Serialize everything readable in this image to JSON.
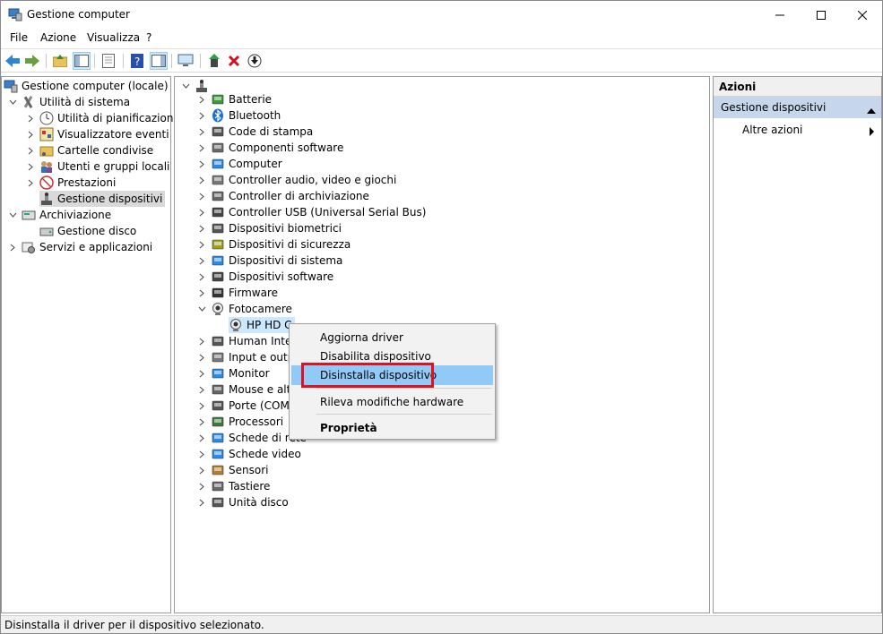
{
  "window": {
    "title": "Gestione computer"
  },
  "menu": {
    "file": "File",
    "action": "Azione",
    "view": "Visualizza",
    "help": "?"
  },
  "tree_left": {
    "root": "Gestione computer (locale)",
    "system_tools": "Utilità di sistema",
    "task_scheduler": "Utilità di pianificazione",
    "event_viewer": "Visualizzatore eventi",
    "shared_folders": "Cartelle condivise",
    "users_groups": "Utenti e gruppi locali",
    "performance": "Prestazioni",
    "device_manager": "Gestione dispositivi",
    "storage": "Archiviazione",
    "disk_management": "Gestione disco",
    "services_apps": "Servizi e applicazioni"
  },
  "devices": {
    "batteries": "Batterie",
    "bluetooth": "Bluetooth",
    "print_queues": "Code di stampa",
    "software_components": "Componenti software",
    "computer": "Computer",
    "audio": "Controller audio, video e giochi",
    "storage_controllers": "Controller di archiviazione",
    "usb": "Controller USB (Universal Serial Bus)",
    "biometric": "Dispositivi biometrici",
    "security": "Dispositivi di sicurezza",
    "system": "Dispositivi di sistema",
    "software_devices": "Dispositivi software",
    "firmware": "Firmware",
    "cameras": "Fotocamere",
    "camera_child": "HP HD C",
    "hid": "Human Inte",
    "io": "Input e outp",
    "monitor": "Monitor",
    "mouse": "Mouse e altr",
    "ports": "Porte (COM",
    "processors": "Processori",
    "network": "Schede di rete",
    "video": "Schede video",
    "sensors": "Sensori",
    "keyboards": "Tastiere",
    "disk_drives": "Unità disco"
  },
  "context_menu": {
    "update_driver": "Aggiorna driver",
    "disable": "Disabilita dispositivo",
    "uninstall": "Disinstalla dispositivo",
    "scan": "Rileva modifiche hardware",
    "properties": "Proprietà"
  },
  "actions": {
    "header": "Azioni",
    "section": "Gestione dispositivi",
    "more": "Altre azioni"
  },
  "status": {
    "text": "Disinstalla il driver per il dispositivo selezionato."
  },
  "colors": {
    "selection_blue": "#cce8ff",
    "context_highlight": "#91c9f7",
    "action_section": "#c6d7eb",
    "red_box": "#e0121f"
  }
}
